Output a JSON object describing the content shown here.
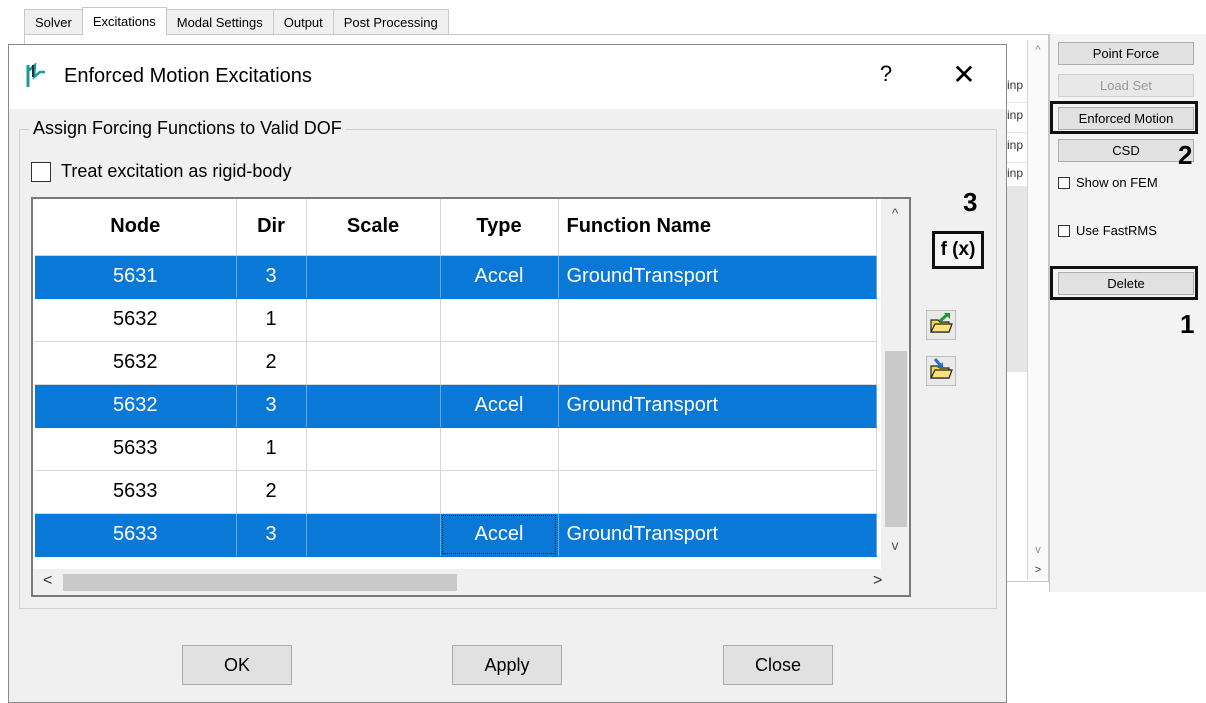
{
  "tabs": [
    "Solver",
    "Excitations",
    "Modal Settings",
    "Output",
    "Post Processing"
  ],
  "bg_row_fragments": [
    "inp",
    "inp",
    "inp",
    "inp"
  ],
  "side_panel": {
    "point_force": "Point Force",
    "load_set": "Load Set",
    "enforced_motion": "Enforced Motion",
    "csd": "CSD",
    "show_on_fem": "Show on FEM",
    "use_fastrms": "Use FastRMS",
    "delete": "Delete"
  },
  "annotations": {
    "one": "1",
    "two": "2",
    "three": "3"
  },
  "dialog": {
    "title": "Enforced Motion Excitations",
    "help": "?",
    "close": "✕",
    "group_title": "Assign Forcing Functions to Valid DOF",
    "rigid_body_label": "Treat excitation as rigid-body",
    "fx_label": "f (x)",
    "buttons": {
      "ok": "OK",
      "apply": "Apply",
      "close": "Close"
    }
  },
  "table": {
    "columns": [
      "Node",
      "Dir",
      "Scale",
      "Type",
      "Function Name"
    ],
    "rows": [
      {
        "node": "5631",
        "dir": "3",
        "scale": "",
        "type": "Accel",
        "function": "GroundTransport",
        "selected": true
      },
      {
        "node": "5632",
        "dir": "1",
        "scale": "",
        "type": "",
        "function": "",
        "selected": false
      },
      {
        "node": "5632",
        "dir": "2",
        "scale": "",
        "type": "",
        "function": "",
        "selected": false
      },
      {
        "node": "5632",
        "dir": "3",
        "scale": "",
        "type": "Accel",
        "function": "GroundTransport",
        "selected": true
      },
      {
        "node": "5633",
        "dir": "1",
        "scale": "",
        "type": "",
        "function": "",
        "selected": false
      },
      {
        "node": "5633",
        "dir": "2",
        "scale": "",
        "type": "",
        "function": "",
        "selected": false
      },
      {
        "node": "5633",
        "dir": "3",
        "scale": "",
        "type": "Accel",
        "function": "GroundTransport",
        "selected": true
      }
    ]
  },
  "colors": {
    "selection": "#0a78d7",
    "highlight_border": "#111111"
  }
}
